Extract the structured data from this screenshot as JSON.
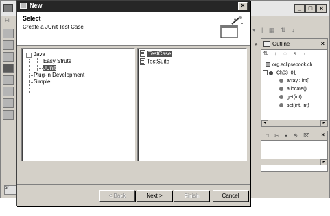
{
  "background_window": {
    "title": "Ja",
    "menu_file": "Fi",
    "bottom_label": "or",
    "outline": {
      "tab_label": "Outline",
      "tab_left_edge": "e",
      "items": [
        {
          "label": "org.eclipsebook.ch",
          "icon": "package-icon"
        },
        {
          "label": "Ch03_01",
          "icon": "class-icon",
          "expander": "-"
        },
        {
          "label": "array : int[]",
          "icon": "field-icon"
        },
        {
          "label": "allocate()",
          "icon": "method-icon"
        },
        {
          "label": "get(int)",
          "icon": "method-icon"
        },
        {
          "label": "set(int, int)",
          "icon": "method-icon"
        }
      ]
    }
  },
  "dialog": {
    "title": "New",
    "close_glyph": "×",
    "header_title": "Select",
    "header_description": "Create a JUnit Test Case",
    "categories": [
      {
        "label": "Java",
        "expander": "−"
      },
      {
        "label": "Easy Struts"
      },
      {
        "label": "JUnit",
        "selected": true
      },
      {
        "label": "Plug-in Development"
      },
      {
        "label": "Simple"
      }
    ],
    "wizards": [
      {
        "label": "TestCase",
        "selected": true
      },
      {
        "label": "TestSuite"
      }
    ],
    "buttons": {
      "back": "< Back",
      "next": "Next >",
      "finish": "Finish",
      "cancel": "Cancel"
    }
  },
  "colors": {
    "dialog_title_bg": "#262626",
    "selection_bg": "#505050",
    "window_bg": "#d4d0c8"
  }
}
